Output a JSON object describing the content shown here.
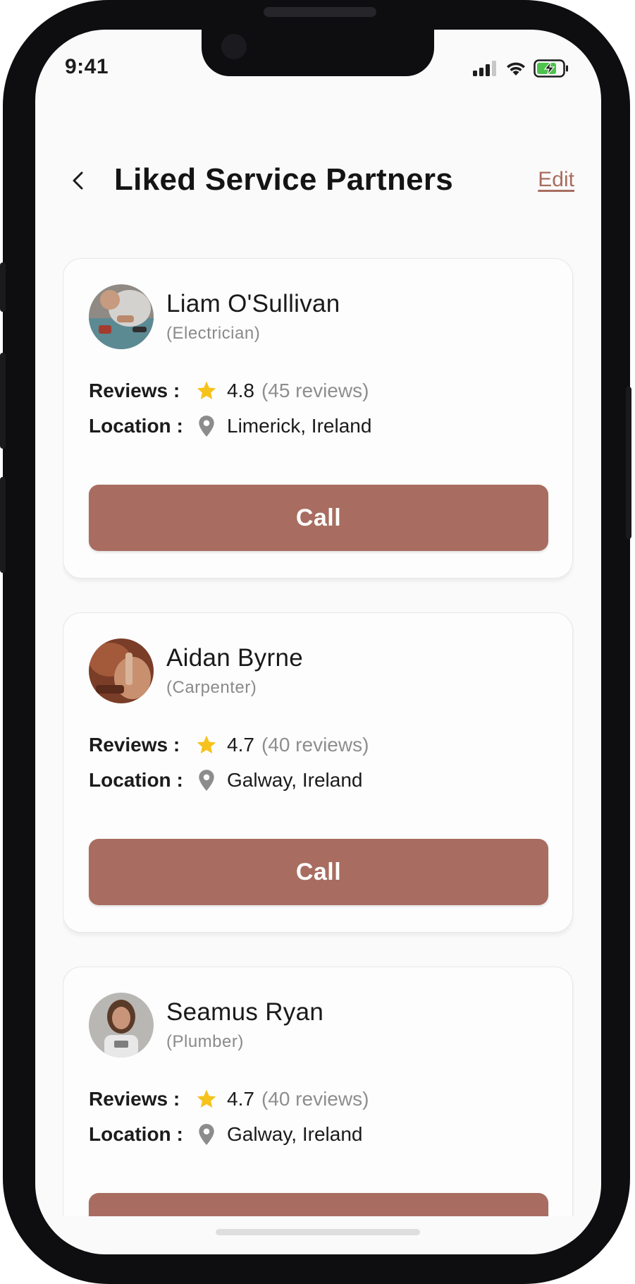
{
  "status_bar": {
    "time": "9:41"
  },
  "header": {
    "title": "Liked Service Partners",
    "edit_label": "Edit"
  },
  "labels": {
    "reviews": "Reviews  :",
    "location": "Location :",
    "call": "Call"
  },
  "partners": [
    {
      "name": "Liam O'Sullivan",
      "role": "(Electrician)",
      "rating": "4.8",
      "review_count": "(45 reviews)",
      "location": "Limerick, Ireland"
    },
    {
      "name": "Aidan Byrne",
      "role": "(Carpenter)",
      "rating": "4.7",
      "review_count": "(40 reviews)",
      "location": "Galway, Ireland"
    },
    {
      "name": "Seamus Ryan",
      "role": "(Plumber)",
      "rating": "4.7",
      "review_count": "(40 reviews)",
      "location": "Galway, Ireland"
    }
  ],
  "colors": {
    "accent": "#a86d60",
    "star": "#f6c21c",
    "pin": "#8c8c8c"
  },
  "icons": {
    "back": "chevron-left-icon",
    "star": "star-icon",
    "location": "map-pin-icon",
    "signal": "signal-icon",
    "wifi": "wifi-icon",
    "battery": "battery-charging-icon"
  }
}
